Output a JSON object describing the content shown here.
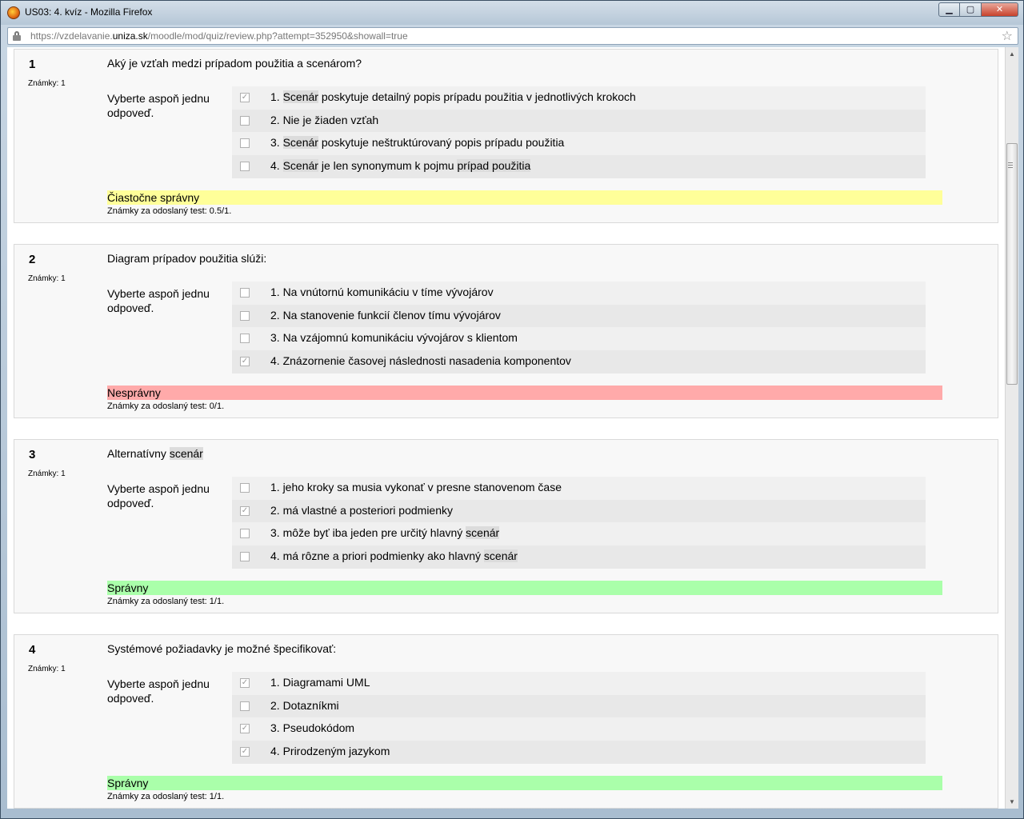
{
  "window": {
    "title": "US03: 4. kvíz - Mozilla Firefox",
    "controls": {
      "minimize": "▁",
      "maximize": "▢",
      "close": "✕"
    }
  },
  "urlbar": {
    "prefix": "https://vzdelavanie.",
    "domain": "uniza.sk",
    "path": "/moodle/mod/quiz/review.php?attempt=352950&showall=true"
  },
  "questions": [
    {
      "number": "1",
      "marks": "Známky: 1",
      "text": "Aký je vzťah medzi prípadom použitia a scenárom?",
      "prompt": "Vyberte aspoň jednu odpoveď.",
      "answers": [
        {
          "parts": [
            "1. ",
            "Scenár",
            " poskytuje detailný popis prípadu použitia v jednotlivých krokoch"
          ],
          "checked": true
        },
        {
          "parts": [
            "2. Nie je žiaden vzťah"
          ],
          "checked": false
        },
        {
          "parts": [
            "3. ",
            "Scenár",
            " poskytuje neštruktúrovaný popis prípadu použitia"
          ],
          "checked": false
        },
        {
          "parts": [
            "4. ",
            "Scenár",
            " je len synonymum k pojmu ",
            "prípad použitia"
          ],
          "checked": false
        }
      ],
      "feedback": "Čiastočne správny",
      "feedback_color": "#ffff99",
      "grade": "Známky za odoslaný test: 0.5/1."
    },
    {
      "number": "2",
      "marks": "Známky: 1",
      "text": "Diagram prípadov použitia slúži:",
      "prompt": "Vyberte aspoň jednu odpoveď.",
      "answers": [
        {
          "parts": [
            "1. Na vnútornú komunikáciu v tíme vývojárov"
          ],
          "checked": false
        },
        {
          "parts": [
            "2. Na stanovenie funkcií členov tímu vývojárov"
          ],
          "checked": false
        },
        {
          "parts": [
            "3. Na vzájomnú komunikáciu vývojárov s klientom"
          ],
          "checked": false
        },
        {
          "parts": [
            "4. Znázornenie časovej následnosti nasadenia komponentov"
          ],
          "checked": true
        }
      ],
      "feedback": "Nesprávny",
      "feedback_color": "#ffaaaa",
      "grade": "Známky za odoslaný test: 0/1."
    },
    {
      "number": "3",
      "marks": "Známky: 1",
      "text": "Alternatívny scenár",
      "prompt": "Vyberte aspoň jednu odpoveď.",
      "answers": [
        {
          "parts": [
            "1. jeho kroky sa musia vykonať v presne stanovenom čase"
          ],
          "checked": false
        },
        {
          "parts": [
            "2. má vlastné a posteriori podmienky"
          ],
          "checked": true
        },
        {
          "parts": [
            "3. môže byť iba jeden pre určitý hlavný ",
            "scenár"
          ],
          "checked": false
        },
        {
          "parts": [
            "4. má rôzne a priori podmienky ako hlavný ",
            "scenár"
          ],
          "checked": false
        }
      ],
      "feedback": "Správny",
      "feedback_color": "#aaffaa",
      "grade": "Známky za odoslaný test: 1/1."
    },
    {
      "number": "4",
      "marks": "Známky: 1",
      "text": "Systémové požiadavky je možné špecifikovať:",
      "prompt": "Vyberte aspoň jednu odpoveď.",
      "answers": [
        {
          "parts": [
            "1. Diagramami UML"
          ],
          "checked": true
        },
        {
          "parts": [
            "2. Dotazníkmi"
          ],
          "checked": false
        },
        {
          "parts": [
            "3. Pseudokódom"
          ],
          "checked": true
        },
        {
          "parts": [
            "4. Prirodzeným jazykom"
          ],
          "checked": true
        }
      ],
      "feedback": "Správny",
      "feedback_color": "#aaffaa",
      "grade": "Známky za odoslaný test: 1/1."
    }
  ]
}
